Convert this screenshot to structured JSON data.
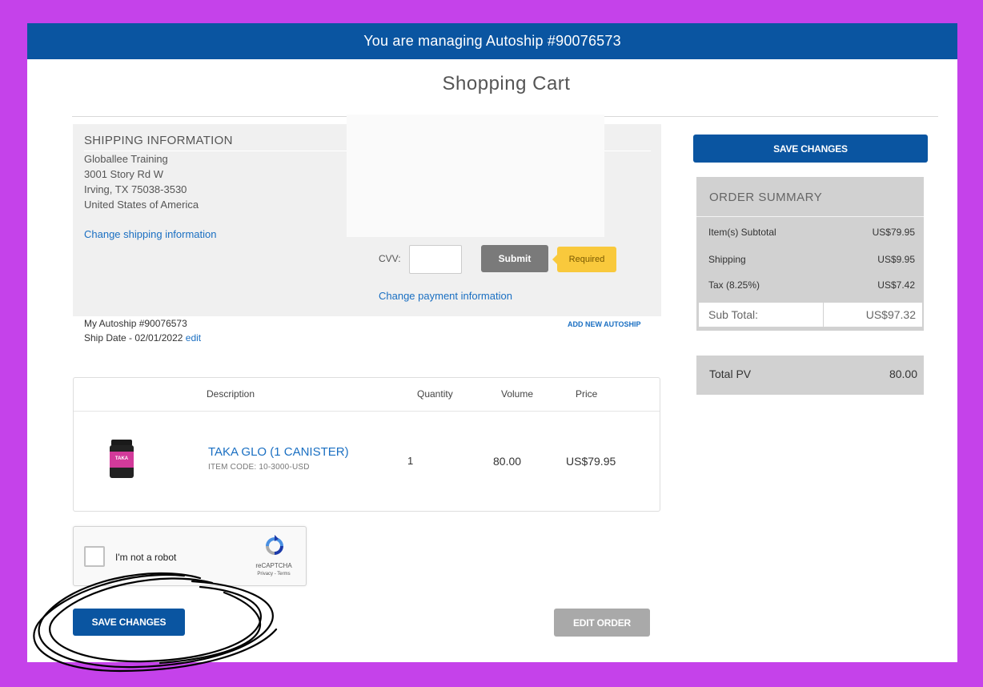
{
  "banner": {
    "text": "You are managing Autoship #90076573"
  },
  "page": {
    "title": "Shopping Cart"
  },
  "shipping": {
    "heading": "SHIPPING INFORMATION",
    "address": [
      "Globallee Training",
      "3001 Story Rd W",
      "Irving, TX 75038-3530",
      "United States of America"
    ],
    "change_link": "Change shipping information"
  },
  "payment": {
    "cvv_label": "CVV:",
    "cvv_value": "",
    "submit_label": "Submit",
    "required_label": "Required",
    "change_link": "Change payment information"
  },
  "autoship": {
    "id_text": "My Autoship #90076573",
    "ship_date_text": "Ship Date - 02/01/2022",
    "edit_label": "edit",
    "add_new_label": "ADD NEW AUTOSHIP"
  },
  "items": {
    "columns": [
      "Description",
      "Quantity",
      "Volume",
      "Price"
    ],
    "rows": [
      {
        "name": "TAKA GLO (1 CANISTER)",
        "code": "ITEM CODE: 10-3000-USD",
        "quantity": "1",
        "volume": "80.00",
        "price": "US$79.95",
        "image_label": "TAKA"
      }
    ]
  },
  "captcha": {
    "label": "I'm not a robot",
    "brand": "reCAPTCHA",
    "terms": "Privacy - Terms"
  },
  "actions": {
    "save_label": "SAVE CHANGES",
    "edit_order_label": "EDIT ORDER"
  },
  "summary": {
    "heading": "ORDER SUMMARY",
    "rows": [
      {
        "label": "Item(s) Subtotal",
        "value": "US$79.95"
      },
      {
        "label": "Shipping",
        "value": "US$9.95"
      },
      {
        "label": "Tax (8.25%)",
        "value": "US$7.42"
      }
    ],
    "subtotal_label": "Sub Total:",
    "subtotal_value": "US$97.32"
  },
  "pv": {
    "label": "Total PV",
    "value": "80.00"
  },
  "colors": {
    "frame": "#c542ea",
    "primary": "#0a55a1",
    "link": "#1a6fc2",
    "required": "#f9c93c",
    "panel": "#f0f0f0",
    "summary": "#d1d1d1"
  }
}
